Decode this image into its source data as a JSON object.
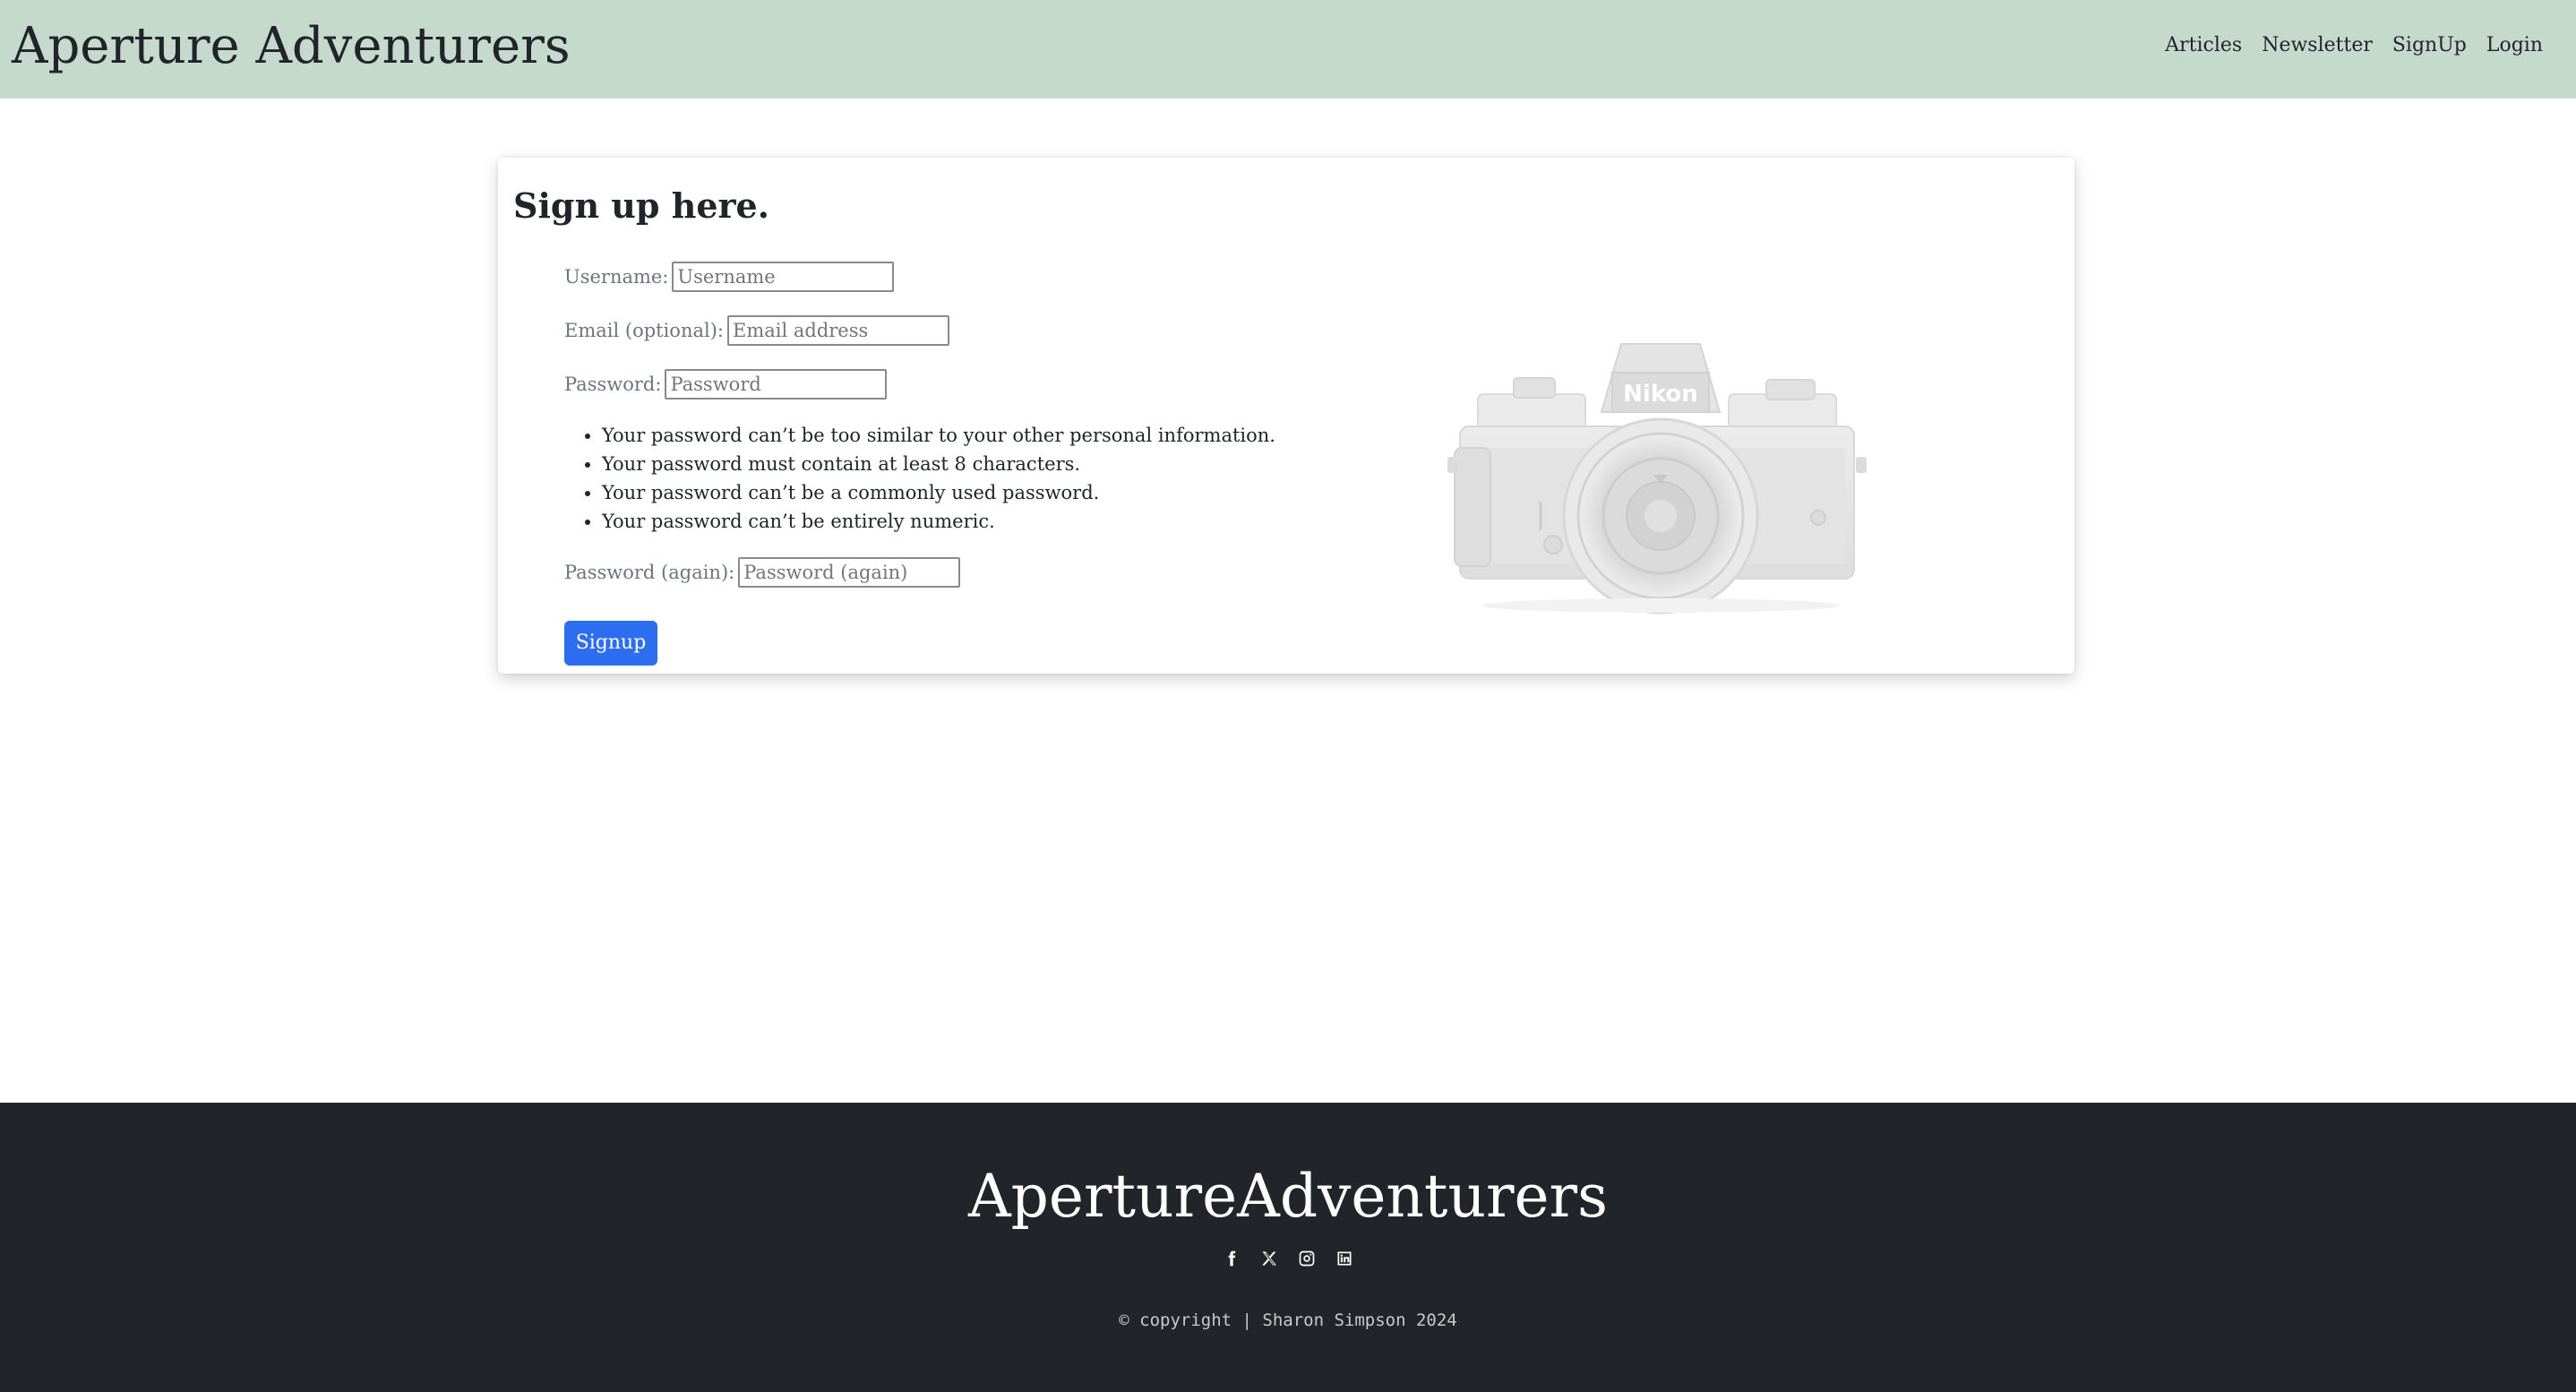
{
  "navbar": {
    "brand": "Aperture Adventurers",
    "links": [
      "Articles",
      "Newsletter",
      "SignUp",
      "Login"
    ]
  },
  "signup_form": {
    "title": "Sign up here.",
    "username": {
      "label": "Username:",
      "placeholder": "Username",
      "value": ""
    },
    "email": {
      "label": "Email (optional):",
      "placeholder": "Email address",
      "value": ""
    },
    "password": {
      "label": "Password:",
      "placeholder": "Password",
      "value": ""
    },
    "password_help": [
      "Your password can’t be too similar to your other personal information.",
      "Your password must contain at least 8 characters.",
      "Your password can’t be a commonly used password.",
      "Your password can’t be entirely numeric."
    ],
    "password_again": {
      "label": "Password (again):",
      "placeholder": "Password (again)",
      "value": ""
    },
    "submit_label": "Signup"
  },
  "camera_image": {
    "brand_text": "Nikon",
    "icon": "camera-image"
  },
  "footer": {
    "brand": "ApertureAdventurers",
    "social_icons": [
      "facebook-icon",
      "x-icon",
      "instagram-icon",
      "linkedin-icon"
    ],
    "copyright_symbol": "©",
    "copyright": "copyright | Sharon Simpson 2024"
  },
  "colors": {
    "navbar_bg": "#c5dacd",
    "footer_bg": "#212529",
    "button_bg": "#2d6df0"
  }
}
